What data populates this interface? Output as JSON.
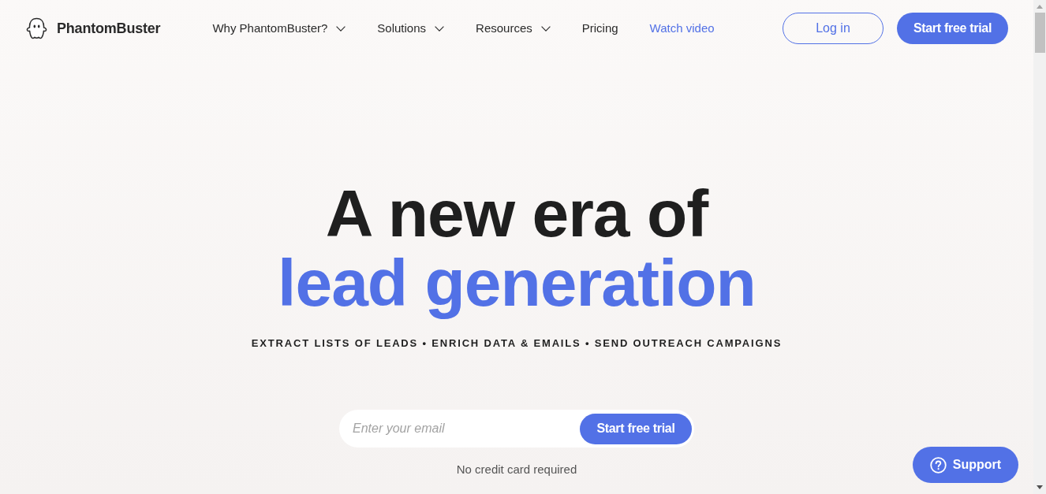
{
  "header": {
    "logo": {
      "text": "PhantomBuster"
    },
    "nav": [
      {
        "label": "Why PhantomBuster?",
        "kind": "dropdown"
      },
      {
        "label": "Solutions",
        "kind": "dropdown"
      },
      {
        "label": "Resources",
        "kind": "dropdown"
      },
      {
        "label": "Pricing",
        "kind": "link"
      },
      {
        "label": "Watch video",
        "kind": "accent"
      }
    ],
    "actions": [
      {
        "label": "Log in",
        "kind": "outline"
      },
      {
        "label": "Start free trial",
        "kind": "primary"
      }
    ]
  },
  "hero": {
    "headline": "A new era of",
    "headline_accent": "lead generation",
    "tagline": "EXTRACT LISTS OF LEADS • ENRICH DATA & EMAILS • SEND OUTREACH CAMPAIGNS"
  },
  "signup": {
    "placeholder": "Enter your email",
    "button": "Start free trial",
    "note": "No credit card required"
  },
  "support_button": {
    "label": "Support"
  }
}
